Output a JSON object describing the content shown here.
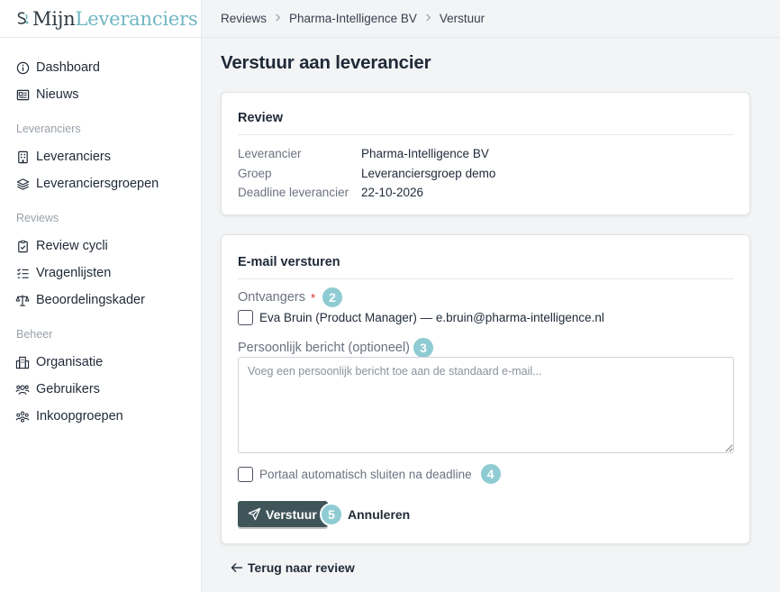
{
  "brand": {
    "name_part1": "Mijn",
    "name_part2": "Leveranciers",
    "accent": "#6fb7c2",
    "dark": "#2f3b44"
  },
  "sidebar": {
    "top_items": [
      {
        "label": "Dashboard",
        "icon": "info-circle-icon"
      },
      {
        "label": "Nieuws",
        "icon": "newspaper-icon"
      }
    ],
    "sections": [
      {
        "title": "Leveranciers",
        "items": [
          {
            "label": "Leveranciers",
            "icon": "building-icon"
          },
          {
            "label": "Leveranciersgroepen",
            "icon": "layers-icon"
          }
        ]
      },
      {
        "title": "Reviews",
        "items": [
          {
            "label": "Review cycli",
            "icon": "clipboard-check-icon"
          },
          {
            "label": "Vragenlijsten",
            "icon": "checklist-icon"
          },
          {
            "label": "Beoordelingskader",
            "icon": "scale-icon"
          }
        ]
      },
      {
        "title": "Beheer",
        "items": [
          {
            "label": "Organisatie",
            "icon": "office-building-icon"
          },
          {
            "label": "Gebruikers",
            "icon": "users-icon"
          },
          {
            "label": "Inkoopgroepen",
            "icon": "group-icon"
          }
        ]
      }
    ]
  },
  "breadcrumb": [
    "Reviews",
    "Pharma-Intelligence BV",
    "Verstuur"
  ],
  "page_title": "Verstuur aan leverancier",
  "review_card": {
    "title": "Review",
    "rows": [
      {
        "key": "Leverancier",
        "value": "Pharma-Intelligence BV"
      },
      {
        "key": "Groep",
        "value": "Leveranciersgroep demo"
      },
      {
        "key": "Deadline leverancier",
        "value": "22-10-2026"
      }
    ]
  },
  "mail_card": {
    "title": "E-mail versturen",
    "recipients_label": "Ontvangers",
    "required_mark": "*",
    "recipient": "Eva Bruin (Product Manager) — e.bruin@pharma-intelligence.nl",
    "recipient_checked": false,
    "message_label": "Persoonlijk bericht (optioneel)",
    "message_placeholder": "Voeg een persoonlijk bericht toe aan de standaard e-mail...",
    "message_value": "",
    "auto_close_label": "Portaal automatisch sluiten na deadline",
    "auto_close_checked": false,
    "send_label": "Verstuur",
    "cancel_label": "Annuleren"
  },
  "badges": {
    "b2": "2",
    "b3": "3",
    "b4": "4",
    "b5": "5",
    "color": "#8fcbd2"
  },
  "back_link": "Terug naar review"
}
